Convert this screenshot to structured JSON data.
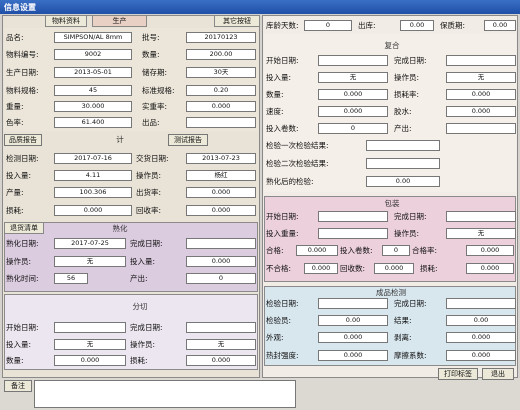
{
  "window": {
    "title": "信息设置"
  },
  "left_tabs": [
    {
      "label": "物料资料"
    },
    {
      "label": "生产"
    },
    {
      "label": "其它按钮"
    }
  ],
  "basic": {
    "rows": [
      {
        "l1": "品名:",
        "v1": "SIMPSON/AL 8mm",
        "l2": "批号:",
        "v2": "20170123"
      },
      {
        "l1": "物料编号:",
        "v1": "9002",
        "l2": "数量:",
        "v2": "200.00"
      },
      {
        "l1": "生产日期:",
        "v1": "2013-05-01",
        "l2": "储存期:",
        "v2": "30天"
      },
      {
        "l1": "物料规格:",
        "v1": "45",
        "l2": "标准规格:",
        "v2": "0.20"
      },
      {
        "l1": "重量:",
        "v1": "30.000",
        "l2": "实重率:",
        "v2": "0.000"
      },
      {
        "l1": "色率:",
        "v1": "61.400",
        "l2": "出品:",
        "v2": ""
      }
    ]
  },
  "mid": {
    "button_left": "品质报告",
    "header": "计",
    "button_right": "测试报告",
    "rows": [
      {
        "l1": "检测日期:",
        "v1": "2017-07-16",
        "l2": "交货日期:",
        "v2": "2013-07-23"
      },
      {
        "l1": "投入量:",
        "v1": "4.11",
        "l2": "操作员:",
        "v2": "杨红"
      },
      {
        "l1": "产量:",
        "v1": "100.306",
        "l2": "出货率:",
        "v2": "0.000"
      },
      {
        "l1": "损耗:",
        "v1": "0.000",
        "l2": "回收率:",
        "v2": "0.000"
      }
    ]
  },
  "section_b": {
    "tab_label": "退货清单",
    "header": "熟化",
    "rows": [
      {
        "l1": "熟化日期:",
        "v1": "2017-07-25",
        "l2": "完成日期:",
        "v2": ""
      },
      {
        "l1": "操作员:",
        "v1": "无",
        "l2": "投入量:",
        "v2": "0.000"
      },
      {
        "l1": "熟化时间:",
        "v1": "56",
        "l2": "产出:",
        "v2": "0"
      }
    ]
  },
  "section_c": {
    "header": "分切",
    "rows": [
      {
        "l1": "开始日期:",
        "v1": "",
        "l2": "完成日期:",
        "v2": ""
      },
      {
        "l1": "投入量:",
        "v1": "无",
        "l2": "操作员:",
        "v2": "无"
      },
      {
        "l1": "数量:",
        "v1": "0.000",
        "l2": "损耗:",
        "v2": "0.000"
      }
    ]
  },
  "right_top": {
    "row": {
      "l1": "库龄天数:",
      "v1": "0",
      "l2": "出库:",
      "v2": "0.00",
      "l3": "保质期:",
      "v3": "0.00"
    }
  },
  "section_d": {
    "header": "复合",
    "rows": [
      {
        "l1": "开始日期:",
        "v1": "",
        "l2": "完成日期:",
        "v2": ""
      },
      {
        "l1": "投入量:",
        "v1": "无",
        "l2": "操作员:",
        "v2": "无"
      },
      {
        "l1": "数量:",
        "v1": "0.000",
        "l2": "损耗率:",
        "v2": "0.000"
      },
      {
        "l1": "速度:",
        "v1": "0.000",
        "l2": "胶水:",
        "v2": "0.000"
      },
      {
        "l1": "投入卷数:",
        "v1": "0",
        "l2": "产出:",
        "v2": ""
      }
    ],
    "text_rows": [
      {
        "label": "检验一次检验结果:"
      },
      {
        "label": "检验二次检验结果:"
      },
      {
        "label": "熟化后的检验:",
        "value": "0.00"
      }
    ]
  },
  "section_e": {
    "header": "包装",
    "rows": [
      {
        "l1": "开始日期:",
        "v1": "",
        "l2": "完成日期:",
        "v2": ""
      },
      {
        "l1": "投入重量:",
        "v1": "",
        "l2": "操作员:",
        "v2": "无"
      }
    ],
    "wide_row": {
      "a": "合格:",
      "av": "0.000",
      "b": "投入卷数:",
      "bv": "0",
      "c": "合格率:",
      "cv": "0.000",
      "d": "不合格:",
      "dv": "0.000",
      "e": "回收数:",
      "ev": "0.000",
      "f": "损耗:",
      "fv": "0.000"
    }
  },
  "section_f": {
    "header": "成品检测",
    "rows": [
      {
        "l1": "检验日期:",
        "v1": "",
        "l2": "完成日期:",
        "v2": ""
      },
      {
        "l1": "检验员:",
        "v1": "0.00",
        "l2": "结果:",
        "v2": "0.00"
      },
      {
        "l1": "外观:",
        "v1": "0.000",
        "l2": "剥离:",
        "v2": "0.000"
      },
      {
        "l1": "热封强度:",
        "v1": "0.000",
        "l2": "摩擦系数:",
        "v2": "0.000"
      }
    ]
  },
  "footer": {
    "note_label": "备注",
    "print_label": "打印标签",
    "exit_label": "退出"
  }
}
